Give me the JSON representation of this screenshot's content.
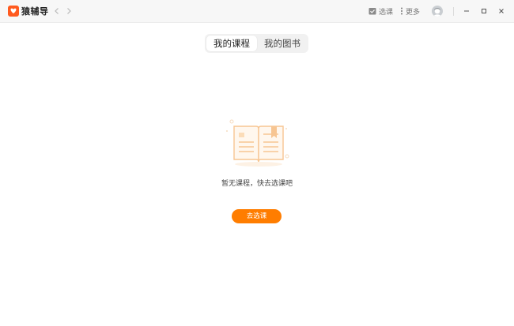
{
  "app": {
    "title": "猿辅导"
  },
  "toolbar": {
    "select_course_label": "选课",
    "more_label": "更多"
  },
  "tabs": [
    {
      "label": "我的课程",
      "active": true
    },
    {
      "label": "我的图书",
      "active": false
    }
  ],
  "empty_state": {
    "message": "暂无课程，快去选课吧",
    "button_label": "去选课"
  },
  "colors": {
    "accent": "#ff7d00",
    "illustration": "#f7c592"
  },
  "icons": [
    "logo-icon",
    "back-arrow-icon",
    "forward-arrow-icon",
    "calendar-check-icon",
    "more-dots-icon",
    "user-avatar-icon",
    "minimize-icon",
    "maximize-icon",
    "close-icon",
    "open-book-icon"
  ]
}
